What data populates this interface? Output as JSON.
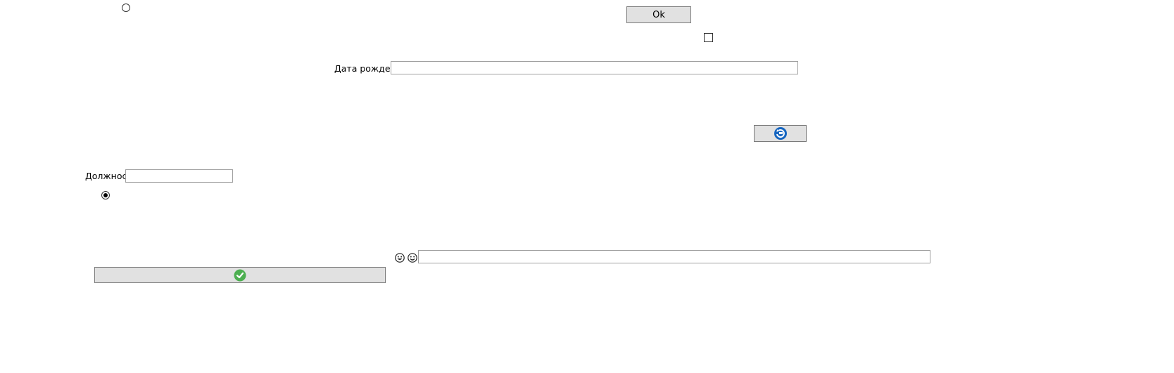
{
  "top_radio": {
    "checked": false
  },
  "ok_button": {
    "label": "Ok"
  },
  "checkbox": {
    "checked": false
  },
  "birth_date": {
    "label": "Дата рождения",
    "value": ""
  },
  "refresh_button": {
    "icon": "refresh-icon",
    "color": "#1565c0"
  },
  "position": {
    "label": "Должность",
    "value": ""
  },
  "selected_radio": {
    "checked": true
  },
  "emoji_input": {
    "icons": [
      "grin-face-icon",
      "smile-face-icon"
    ],
    "value": ""
  },
  "confirm_button": {
    "icon": "check-circle-icon",
    "color": "#4caf50"
  }
}
